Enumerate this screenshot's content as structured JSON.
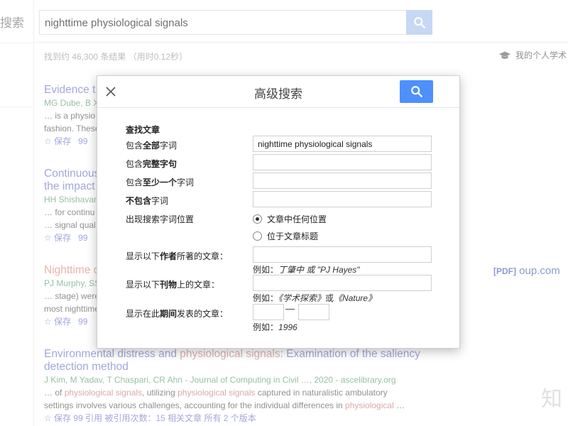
{
  "left_col": {
    "logo_text": "搜索"
  },
  "search": {
    "query": "nighttime physiological signals"
  },
  "stats": {
    "prefix": "找到约 46,300 条结果",
    "time": "（用时0.12秒）"
  },
  "my_library": "我的个人学术",
  "results": [
    {
      "title": "Evidence t",
      "meta": "MG Dube, B X",
      "snip1": "… is a physio",
      "snip2": "fashion. These",
      "save": "保存",
      "cite": "99"
    },
    {
      "title": "Continuous",
      "title2": "the impact",
      "meta": "HH Shishavar",
      "snip1": "… for continu",
      "snip2": "… signal qual",
      "save": "保存",
      "cite": "99"
    },
    {
      "title": "Nighttime c",
      "meta": "PJ Murphy, SS",
      "snip1": "… stage) were",
      "snip2": "most nighttime",
      "save": "保存",
      "cite": "99"
    },
    {
      "title_a": "Environmental distress and ",
      "title_hl": "physiological signals",
      "title_b": ": Examination of the saliency",
      "title2": "detection method",
      "meta": "J Kim, M Yadav, T Chaspari, CR Ahn - Journal of Computing in Civil …, 2020 - ascelibrary.org",
      "snip1_a": "… of ",
      "snip1_hl": "physiological signals",
      "snip1_b": ", utilizing ",
      "snip1_hl2": "physiological signals",
      "snip1_c": " captured in naturalistic ambulatory",
      "snip2_a": "settings involves various challenges, accounting for the individual differences in ",
      "snip2_hl": "physiological",
      "snip2_b": " …",
      "acts": "☆ 保存  99 引用  被引用次数：15  相关文章  所有 2 个版本"
    }
  ],
  "pdf": {
    "tag": "[PDF]",
    "site": "oup.com"
  },
  "watermark": "知",
  "modal": {
    "title": "高级搜索",
    "section": "查找文章",
    "rows": {
      "all_words": {
        "pre": "包含",
        "bold": "全部",
        "post": "字词",
        "value": "nighttime physiological signals"
      },
      "exact": {
        "pre": "包含",
        "bold": "完整字句",
        "post": "",
        "value": ""
      },
      "atleast": {
        "pre": "包含",
        "bold": "至少一个",
        "post": "字词",
        "value": ""
      },
      "without": {
        "pre": "",
        "bold": "不包含",
        "post": "字词",
        "value": ""
      }
    },
    "occurs_label": "出现搜索字词位置",
    "occurs_options": [
      "文章中任何位置",
      "位于文章标题"
    ],
    "author": {
      "pre": "显示以下",
      "bold": "作者",
      "post": "所著的文章：",
      "hint_pre": "例如：",
      "hint_ex": "丁肇中 或 \"PJ Hayes\""
    },
    "publication": {
      "pre": "显示以下",
      "bold": "刊物",
      "post": "上的文章：",
      "hint_pre": "例如：",
      "hint_ex1": "《学术探索》",
      "hint_mid": "或",
      "hint_ex2": "《Nature》"
    },
    "dates": {
      "pre": "显示在此",
      "bold": "期间",
      "post": "发表的文章：",
      "dash": "—",
      "hint_pre": "例如：",
      "hint_ex": "1996"
    }
  },
  "colors": {
    "accent": "#4d90fe",
    "link": "#6f78c9",
    "highlight": "#c77b7b",
    "meta_green": "#5e9e74"
  },
  "icons": [
    "search-icon",
    "close-icon",
    "graduation-cap-icon",
    "star-icon",
    "quote-icon"
  ]
}
